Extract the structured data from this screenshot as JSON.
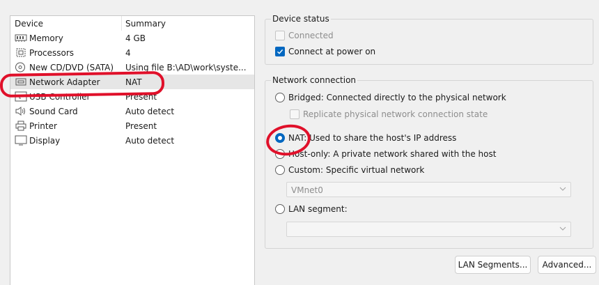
{
  "device_list": {
    "columns": {
      "device": "Device",
      "summary": "Summary"
    },
    "rows": [
      {
        "icon": "memory-icon",
        "device": "Memory",
        "summary": "4 GB"
      },
      {
        "icon": "processor-icon",
        "device": "Processors",
        "summary": "4"
      },
      {
        "icon": "cd-dvd-icon",
        "device": "New CD/DVD (SATA)",
        "summary": "Using file B:\\AD\\work\\syste..."
      },
      {
        "icon": "network-adapter-icon",
        "device": "Network Adapter",
        "summary": "NAT",
        "selected": true
      },
      {
        "icon": "usb-controller-icon",
        "device": "USB Controller",
        "summary": "Present"
      },
      {
        "icon": "sound-card-icon",
        "device": "Sound Card",
        "summary": "Auto detect"
      },
      {
        "icon": "printer-icon",
        "device": "Printer",
        "summary": "Present"
      },
      {
        "icon": "display-icon",
        "device": "Display",
        "summary": "Auto detect"
      }
    ]
  },
  "device_status": {
    "title": "Device status",
    "connected": {
      "label": "Connected",
      "checked": false,
      "enabled": false
    },
    "connect_at_power_on": {
      "label": "Connect at power on",
      "checked": true
    }
  },
  "network_connection": {
    "title": "Network connection",
    "bridged": {
      "label": "Bridged: Connected directly to the physical network",
      "selected": false
    },
    "replicate": {
      "label": "Replicate physical network connection state",
      "checked": false,
      "enabled": false
    },
    "nat": {
      "label": "NAT: Used to share the host's IP address",
      "selected": true
    },
    "host_only": {
      "label": "Host-only: A private network shared with the host",
      "selected": false
    },
    "custom": {
      "label": "Custom: Specific virtual network",
      "selected": false
    },
    "custom_network": {
      "value": "VMnet0"
    },
    "lan_segment": {
      "label": "LAN segment:",
      "selected": false
    },
    "lan_segment_value": {
      "value": ""
    }
  },
  "buttons": {
    "lan_segments": "LAN Segments...",
    "advanced": "Advanced..."
  },
  "colors": {
    "accent": "#0067c0",
    "annotation": "#e0102a",
    "selection": "#e6e6e6"
  }
}
